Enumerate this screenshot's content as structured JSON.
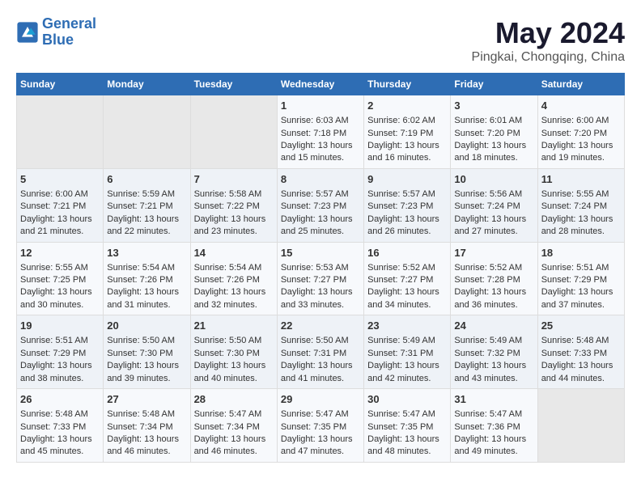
{
  "header": {
    "logo_line1": "General",
    "logo_line2": "Blue",
    "title": "May 2024",
    "subtitle": "Pingkai, Chongqing, China"
  },
  "days_of_week": [
    "Sunday",
    "Monday",
    "Tuesday",
    "Wednesday",
    "Thursday",
    "Friday",
    "Saturday"
  ],
  "weeks": [
    [
      {
        "day": "",
        "info": ""
      },
      {
        "day": "",
        "info": ""
      },
      {
        "day": "",
        "info": ""
      },
      {
        "day": "1",
        "info": "Sunrise: 6:03 AM\nSunset: 7:18 PM\nDaylight: 13 hours\nand 15 minutes."
      },
      {
        "day": "2",
        "info": "Sunrise: 6:02 AM\nSunset: 7:19 PM\nDaylight: 13 hours\nand 16 minutes."
      },
      {
        "day": "3",
        "info": "Sunrise: 6:01 AM\nSunset: 7:20 PM\nDaylight: 13 hours\nand 18 minutes."
      },
      {
        "day": "4",
        "info": "Sunrise: 6:00 AM\nSunset: 7:20 PM\nDaylight: 13 hours\nand 19 minutes."
      }
    ],
    [
      {
        "day": "5",
        "info": "Sunrise: 6:00 AM\nSunset: 7:21 PM\nDaylight: 13 hours\nand 21 minutes."
      },
      {
        "day": "6",
        "info": "Sunrise: 5:59 AM\nSunset: 7:21 PM\nDaylight: 13 hours\nand 22 minutes."
      },
      {
        "day": "7",
        "info": "Sunrise: 5:58 AM\nSunset: 7:22 PM\nDaylight: 13 hours\nand 23 minutes."
      },
      {
        "day": "8",
        "info": "Sunrise: 5:57 AM\nSunset: 7:23 PM\nDaylight: 13 hours\nand 25 minutes."
      },
      {
        "day": "9",
        "info": "Sunrise: 5:57 AM\nSunset: 7:23 PM\nDaylight: 13 hours\nand 26 minutes."
      },
      {
        "day": "10",
        "info": "Sunrise: 5:56 AM\nSunset: 7:24 PM\nDaylight: 13 hours\nand 27 minutes."
      },
      {
        "day": "11",
        "info": "Sunrise: 5:55 AM\nSunset: 7:24 PM\nDaylight: 13 hours\nand 28 minutes."
      }
    ],
    [
      {
        "day": "12",
        "info": "Sunrise: 5:55 AM\nSunset: 7:25 PM\nDaylight: 13 hours\nand 30 minutes."
      },
      {
        "day": "13",
        "info": "Sunrise: 5:54 AM\nSunset: 7:26 PM\nDaylight: 13 hours\nand 31 minutes."
      },
      {
        "day": "14",
        "info": "Sunrise: 5:54 AM\nSunset: 7:26 PM\nDaylight: 13 hours\nand 32 minutes."
      },
      {
        "day": "15",
        "info": "Sunrise: 5:53 AM\nSunset: 7:27 PM\nDaylight: 13 hours\nand 33 minutes."
      },
      {
        "day": "16",
        "info": "Sunrise: 5:52 AM\nSunset: 7:27 PM\nDaylight: 13 hours\nand 34 minutes."
      },
      {
        "day": "17",
        "info": "Sunrise: 5:52 AM\nSunset: 7:28 PM\nDaylight: 13 hours\nand 36 minutes."
      },
      {
        "day": "18",
        "info": "Sunrise: 5:51 AM\nSunset: 7:29 PM\nDaylight: 13 hours\nand 37 minutes."
      }
    ],
    [
      {
        "day": "19",
        "info": "Sunrise: 5:51 AM\nSunset: 7:29 PM\nDaylight: 13 hours\nand 38 minutes."
      },
      {
        "day": "20",
        "info": "Sunrise: 5:50 AM\nSunset: 7:30 PM\nDaylight: 13 hours\nand 39 minutes."
      },
      {
        "day": "21",
        "info": "Sunrise: 5:50 AM\nSunset: 7:30 PM\nDaylight: 13 hours\nand 40 minutes."
      },
      {
        "day": "22",
        "info": "Sunrise: 5:50 AM\nSunset: 7:31 PM\nDaylight: 13 hours\nand 41 minutes."
      },
      {
        "day": "23",
        "info": "Sunrise: 5:49 AM\nSunset: 7:31 PM\nDaylight: 13 hours\nand 42 minutes."
      },
      {
        "day": "24",
        "info": "Sunrise: 5:49 AM\nSunset: 7:32 PM\nDaylight: 13 hours\nand 43 minutes."
      },
      {
        "day": "25",
        "info": "Sunrise: 5:48 AM\nSunset: 7:33 PM\nDaylight: 13 hours\nand 44 minutes."
      }
    ],
    [
      {
        "day": "26",
        "info": "Sunrise: 5:48 AM\nSunset: 7:33 PM\nDaylight: 13 hours\nand 45 minutes."
      },
      {
        "day": "27",
        "info": "Sunrise: 5:48 AM\nSunset: 7:34 PM\nDaylight: 13 hours\nand 46 minutes."
      },
      {
        "day": "28",
        "info": "Sunrise: 5:47 AM\nSunset: 7:34 PM\nDaylight: 13 hours\nand 46 minutes."
      },
      {
        "day": "29",
        "info": "Sunrise: 5:47 AM\nSunset: 7:35 PM\nDaylight: 13 hours\nand 47 minutes."
      },
      {
        "day": "30",
        "info": "Sunrise: 5:47 AM\nSunset: 7:35 PM\nDaylight: 13 hours\nand 48 minutes."
      },
      {
        "day": "31",
        "info": "Sunrise: 5:47 AM\nSunset: 7:36 PM\nDaylight: 13 hours\nand 49 minutes."
      },
      {
        "day": "",
        "info": ""
      }
    ]
  ]
}
